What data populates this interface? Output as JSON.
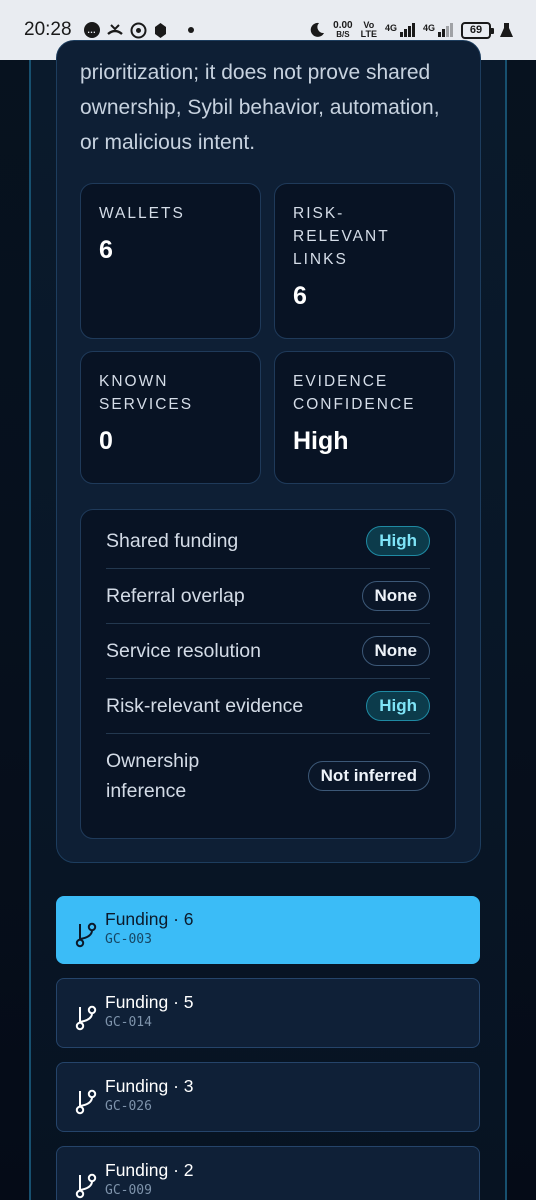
{
  "status_bar": {
    "time": "20:28",
    "speed_value": "0.00",
    "speed_unit": "B/S",
    "volte_top": "Vo",
    "volte_bottom": "LTE",
    "net1": "4G",
    "net2": "4G",
    "battery": "69"
  },
  "panel": {
    "disclaimer": "prioritization; it does not prove shared ownership, Sybil behavior, automation, or malicious intent."
  },
  "stats": [
    {
      "label": "WALLETS",
      "value": "6"
    },
    {
      "label": "RISK-\nRELEVANT\nLINKS",
      "value": "6"
    },
    {
      "label": "KNOWN\nSERVICES",
      "value": "0"
    },
    {
      "label": "EVIDENCE\nCONFIDENCE",
      "value": "High"
    }
  ],
  "evidence": [
    {
      "label": "Shared funding",
      "level": "High"
    },
    {
      "label": "Referral overlap",
      "level": "None"
    },
    {
      "label": "Service resolution",
      "level": "None"
    },
    {
      "label": "Risk-relevant evidence",
      "level": "High"
    },
    {
      "label": "Ownership inference",
      "level": "Not inferred"
    }
  ],
  "clusters": [
    {
      "title": "Funding · 6",
      "id": "GC-003",
      "active": true
    },
    {
      "title": "Funding · 5",
      "id": "GC-014",
      "active": false
    },
    {
      "title": "Funding · 3",
      "id": "GC-026",
      "active": false
    },
    {
      "title": "Funding · 2",
      "id": "GC-009",
      "active": false
    }
  ],
  "colors": {
    "accent": "#3bbcf7",
    "high_pill_text": "#7fe4f7",
    "card_bg": "#081324"
  }
}
